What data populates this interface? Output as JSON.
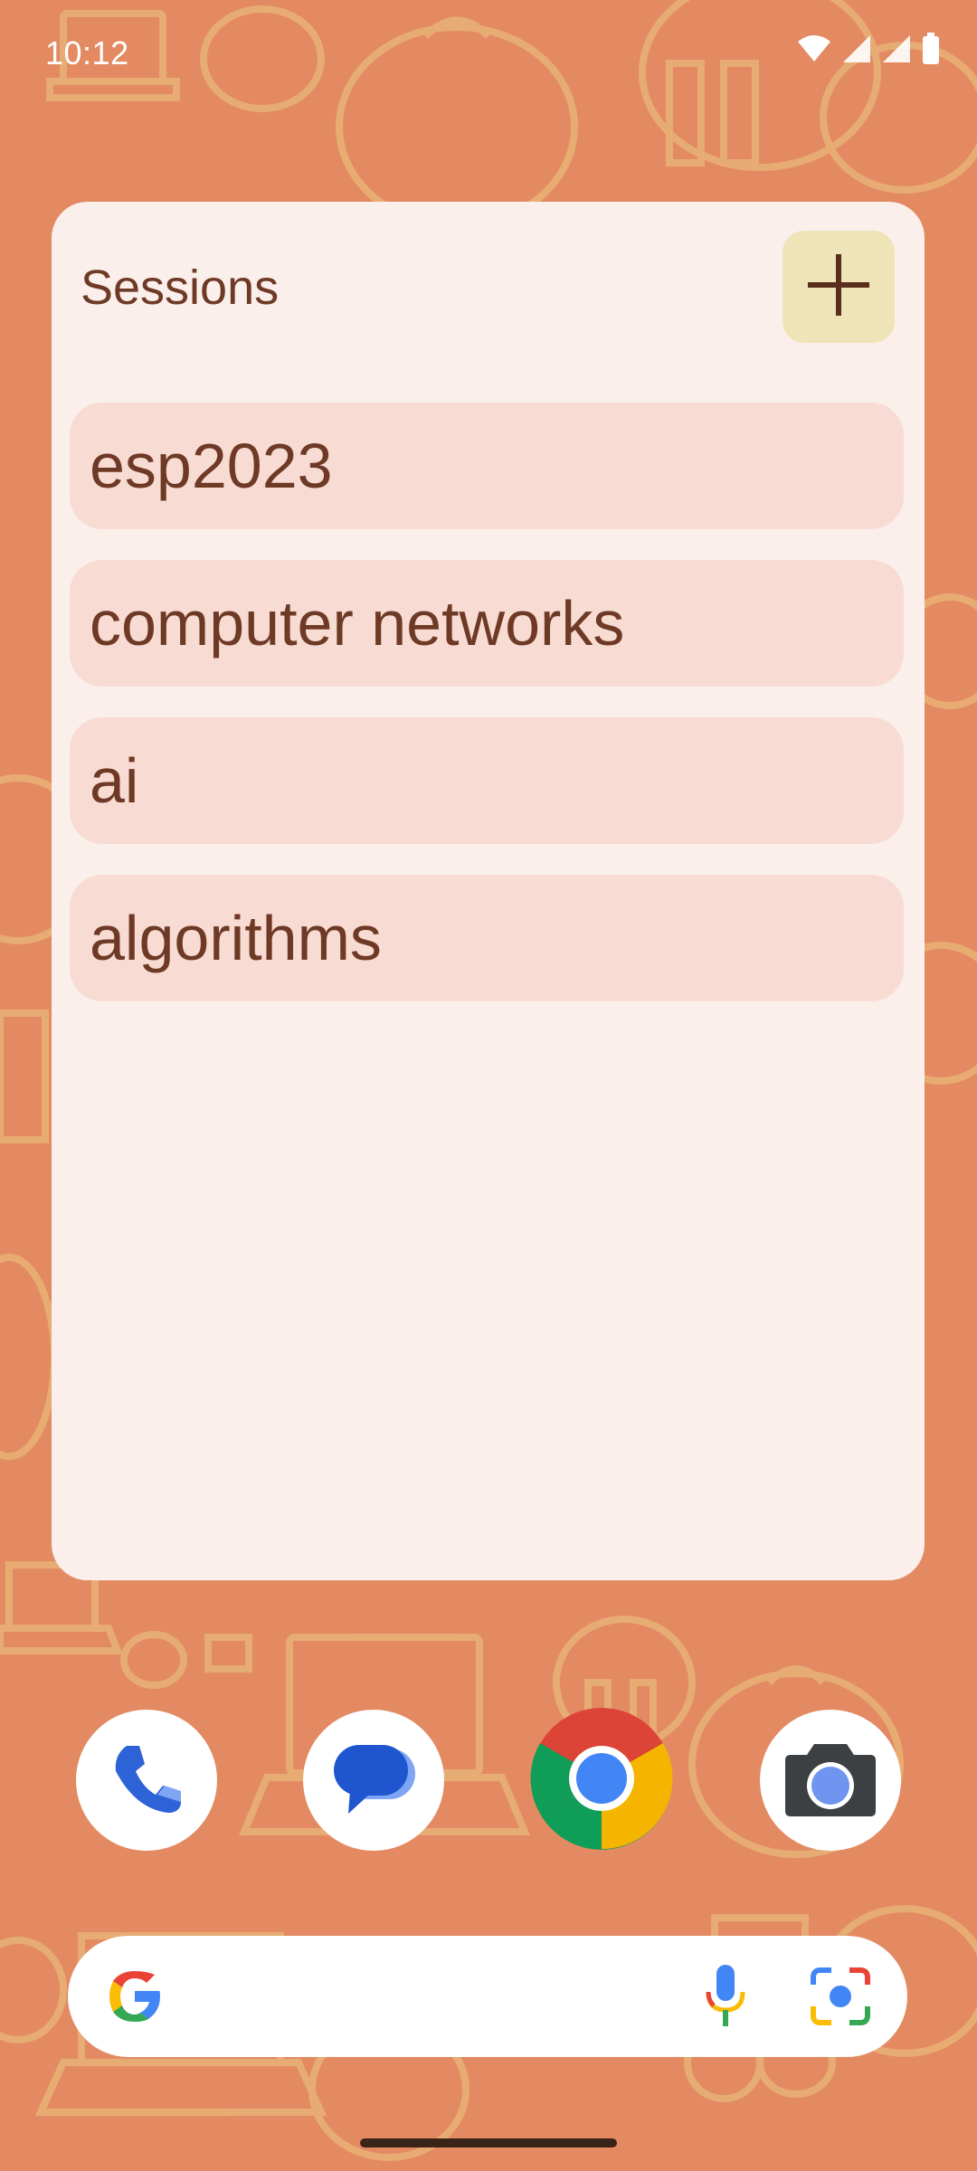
{
  "status_bar": {
    "time": "10:12"
  },
  "widget": {
    "title": "Sessions",
    "add_icon": "plus-icon",
    "sessions": [
      {
        "label": "esp2023"
      },
      {
        "label": "computer networks"
      },
      {
        "label": "ai"
      },
      {
        "label": "algorithms"
      }
    ]
  },
  "dock": {
    "apps": [
      {
        "icon": "phone-icon"
      },
      {
        "icon": "messages-icon"
      },
      {
        "icon": "chrome-icon"
      },
      {
        "icon": "camera-icon"
      }
    ]
  },
  "search_bar": {
    "logo_icon": "google-g-icon",
    "mic_icon": "microphone-icon",
    "lens_icon": "lens-icon"
  },
  "colors": {
    "wallpaper": "#E38A62",
    "widget_bg": "#FBEFEB",
    "item_bg": "#F8DCD3",
    "text": "#6E3A26",
    "add_button_bg": "#EFE3B8"
  }
}
